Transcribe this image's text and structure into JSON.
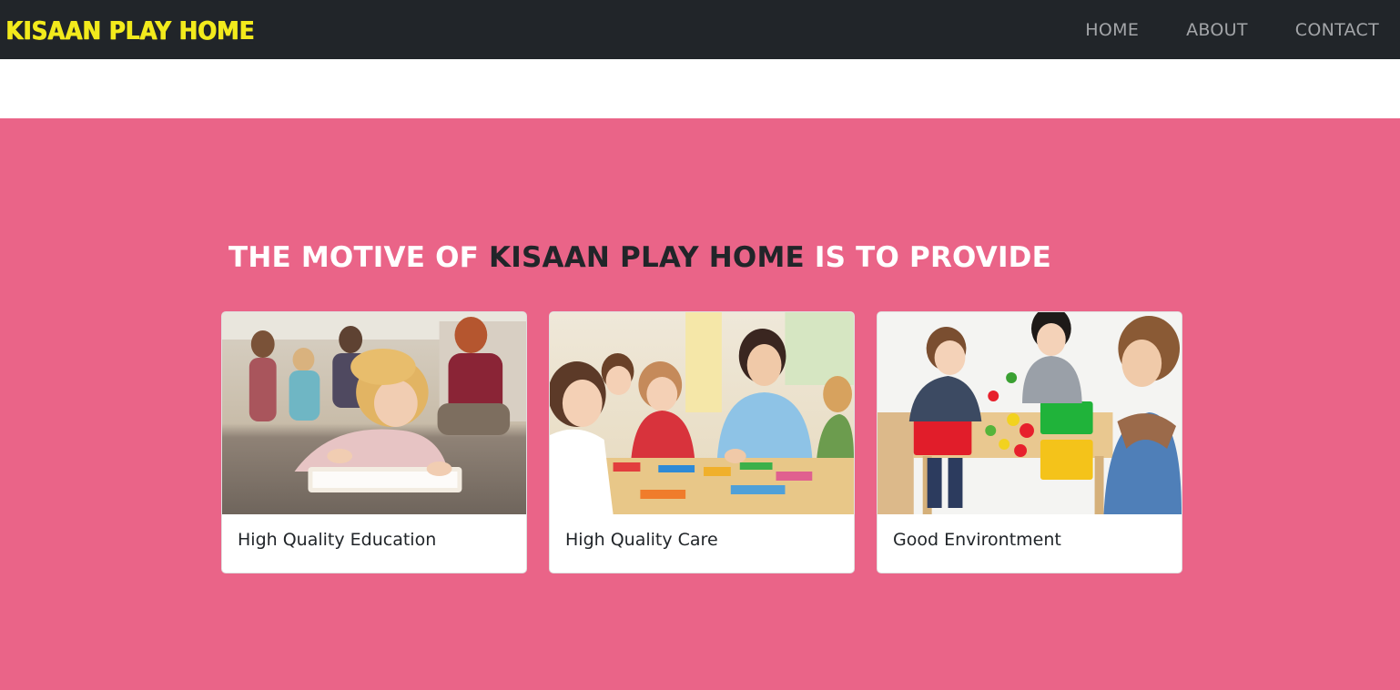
{
  "navbar": {
    "brand": "KISAAN PLAY HOME",
    "links": [
      {
        "label": "HOME"
      },
      {
        "label": "ABOUT"
      },
      {
        "label": "CONTACT"
      }
    ]
  },
  "hero": {
    "heading_prefix": "THE MOTIVE OF ",
    "heading_accent": "KISAAN PLAY HOME",
    "heading_suffix": " IS TO PROVIDE"
  },
  "cards": [
    {
      "title": "High Quality Education",
      "image": "girl-reading-book-photo"
    },
    {
      "title": "High Quality Care",
      "image": "teacher-with-children-photo"
    },
    {
      "title": "Good Environtment",
      "image": "kids-playing-with-baskets-photo"
    }
  ],
  "colors": {
    "navbar_bg": "#212529",
    "brand": "#f2ea1c",
    "nav_link": "#a3a5a8",
    "section_bg": "#ea6488",
    "heading": "#ffffff",
    "heading_accent": "#212529"
  }
}
